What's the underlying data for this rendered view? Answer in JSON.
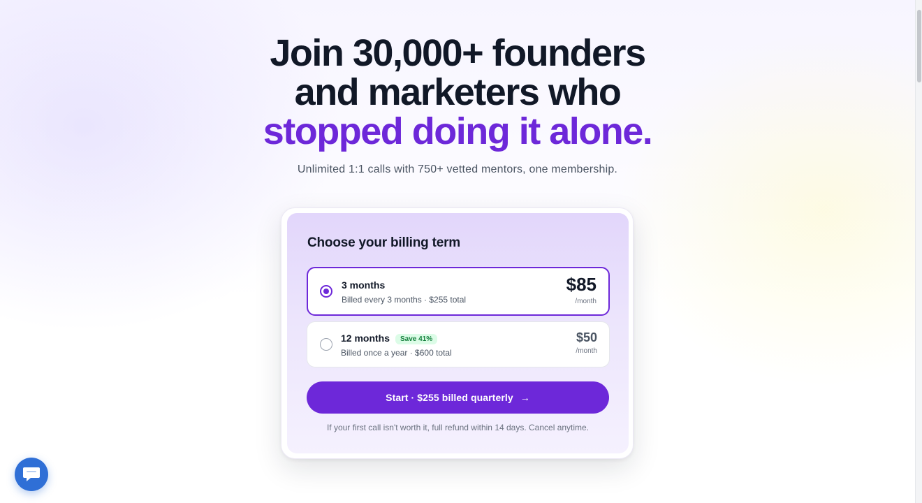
{
  "hero": {
    "headline_line1": "Join 30,000+ founders",
    "headline_line2": "and marketers who",
    "headline_accent": "stopped doing it alone.",
    "subtitle": "Unlimited 1:1 calls with 750+ vetted mentors, one membership."
  },
  "billing": {
    "title": "Choose your billing term",
    "options": [
      {
        "name": "3 months",
        "description": "Billed every 3 months · $255 total",
        "price": "$85",
        "per": "/month",
        "selected": true
      },
      {
        "name": "12 months",
        "badge": "Save 41%",
        "description": "Billed once a year · $600 total",
        "price": "$50",
        "per": "/month",
        "selected": false
      }
    ],
    "cta_label": "Start · $255 billed quarterly",
    "cta_arrow": "→",
    "note": "If your first call isn't worth it, full refund within 14 days. Cancel anytime."
  },
  "colors": {
    "accent": "#6d28d9",
    "heading": "#111827",
    "badge_text": "#15803d",
    "badge_bg": "#dcfce7",
    "chat_button": "#2f6fd6"
  },
  "icons": {
    "chat": "chat-icon",
    "arrow": "arrow-right-icon"
  }
}
